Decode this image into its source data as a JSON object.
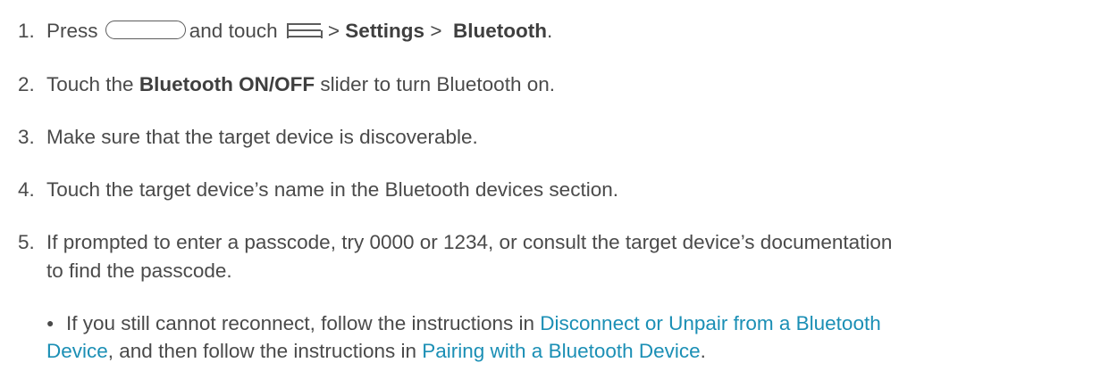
{
  "steps": [
    {
      "number": "1.",
      "press": "Press",
      "and_touch": "and touch",
      "sep1": ">",
      "settings": "Settings",
      "sep2": ">",
      "bluetooth": "Bluetooth",
      "end": "."
    },
    {
      "number": "2.",
      "before": "Touch the",
      "bold": "Bluetooth ON/OFF",
      "after": "slider to turn Bluetooth on."
    },
    {
      "number": "3.",
      "text": "Make sure that the target device is discoverable."
    },
    {
      "number": "4.",
      "text": "Touch the target device’s name in the Bluetooth devices section."
    },
    {
      "number": "5.",
      "line1": "If prompted to enter a passcode, try 0000 or 1234, or consult the target device’s documentation",
      "line2": "to find the passcode."
    }
  ],
  "bullet": {
    "symbol": "●",
    "before_link1": "If you still cannot reconnect, follow the instructions in",
    "link1_part1": "Disconnect or Unpair from a Bluetooth",
    "link1_part2": "Device",
    "middle": ", and then follow the instructions in",
    "link2": "Pairing with a Bluetooth Device",
    "end": "."
  },
  "icons": [
    "home-button-icon",
    "menu-icon"
  ],
  "colors": {
    "text": "#4a4a4a",
    "link": "#1b8fb5"
  }
}
